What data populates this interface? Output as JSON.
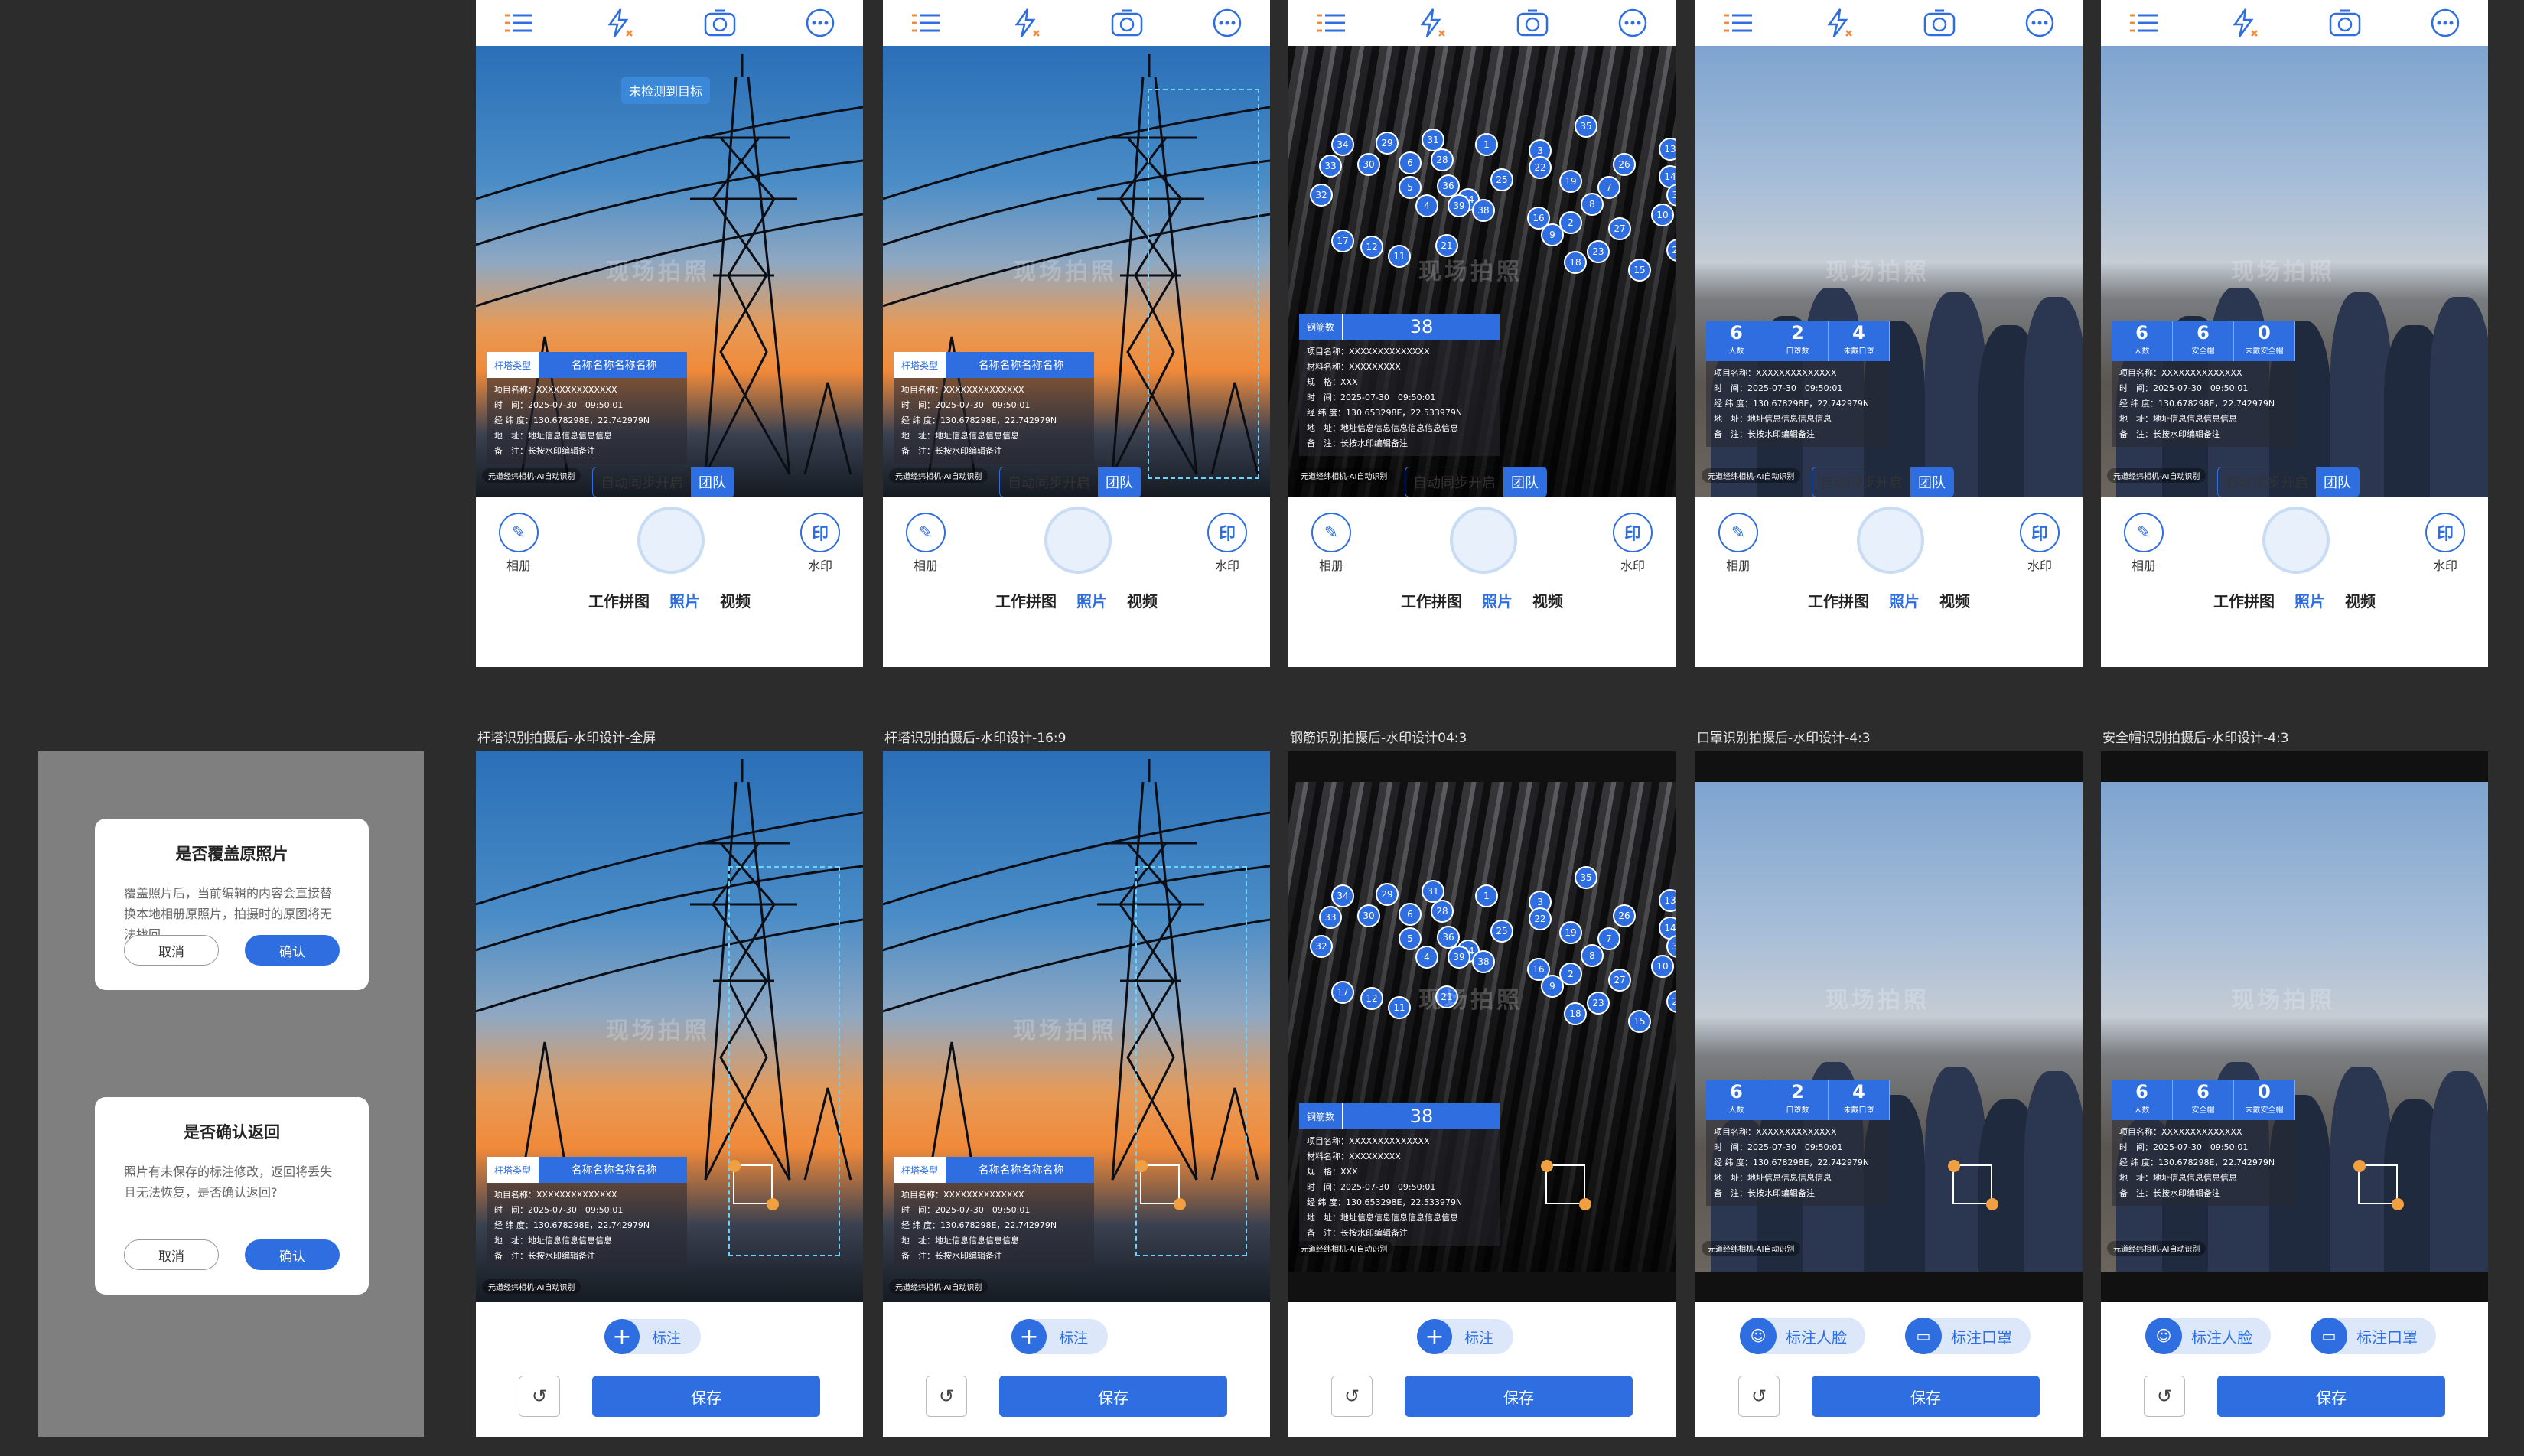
{
  "dialogs": [
    {
      "title": "是否覆盖原照片",
      "message": "覆盖照片后，当前编辑的内容会直接替换本地相册原照片，拍摄时的原图将无法找回。",
      "cancel": "取消",
      "confirm": "确认"
    },
    {
      "title": "是否确认返回",
      "message": "照片有未保存的标注修改，返回将丢失且无法恢复，是否确认返回?",
      "cancel": "取消",
      "confirm": "确认"
    }
  ],
  "captions": [
    "杆塔识别拍摄后-水印设计-全屏",
    "杆塔识别拍摄后-水印设计-16:9",
    "钢筋识别拍摄后-水印设计04:3",
    "口罩识别拍摄后-水印设计-4:3",
    "安全帽识别拍摄后-水印设计-4:3"
  ],
  "camera": {
    "sync_label": "自动同步开启",
    "team_label": "团队",
    "album": "相册",
    "watermark": "水印",
    "mode_puzzle": "工作拼图",
    "mode_photo": "照片",
    "mode_video": "视频",
    "stamp_char": "印",
    "no_target": "未检测到目标"
  },
  "watermark": {
    "tower_key": "杆塔类型",
    "tower_val": "名称名称名称名称",
    "rebar_key": "钢筋数",
    "rebar_val": "38",
    "rows": [
      "项目名称：XXXXXXXXXXXXXX",
      "时　间：2025-07-30　09:50:01",
      "经 纬 度：130.678298E，22.742979N",
      "地　址：地址信息信息信息信息",
      "备　注：长按水印编辑备注"
    ],
    "rebar_rows": [
      "项目名称：XXXXXXXXXXXXXX",
      "材料名称：XXXXXXXXX",
      "规　格：XXX",
      "时　间：2025-07-30　09:50:01",
      "经 纬 度：130.653298E，22.533979N",
      "地　址：地址信息信息信息信息信息信息",
      "备　注：长按水印编辑备注"
    ],
    "footer": "元道经纬相机-AI自动识别",
    "watermark_text": "现场拍照",
    "mask_counts": [
      {
        "n": "6",
        "l": "人数"
      },
      {
        "n": "2",
        "l": "口罩数"
      },
      {
        "n": "4",
        "l": "未戴口罩"
      }
    ],
    "helmet_counts": [
      {
        "n": "6",
        "l": "人数"
      },
      {
        "n": "6",
        "l": "安全帽"
      },
      {
        "n": "0",
        "l": "未戴安全帽"
      }
    ]
  },
  "edit": {
    "annotate": "标注",
    "face": "标注人脸",
    "mask": "标注口罩",
    "save": "保存",
    "undo": "↺"
  },
  "rebar_bubbles": [
    "34",
    "29",
    "31",
    "1",
    "3",
    "35",
    "13",
    "33",
    "30",
    "6",
    "28",
    "22",
    "26",
    "14",
    "5",
    "36",
    "25",
    "24",
    "32",
    "4",
    "39",
    "38",
    "19",
    "8",
    "7",
    "37",
    "10",
    "16",
    "9",
    "2",
    "27",
    "23",
    "17",
    "12",
    "11",
    "21",
    "18",
    "15",
    "20"
  ],
  "colors": {
    "primary": "#2f6ee0",
    "bg": "#2c2c2c"
  }
}
